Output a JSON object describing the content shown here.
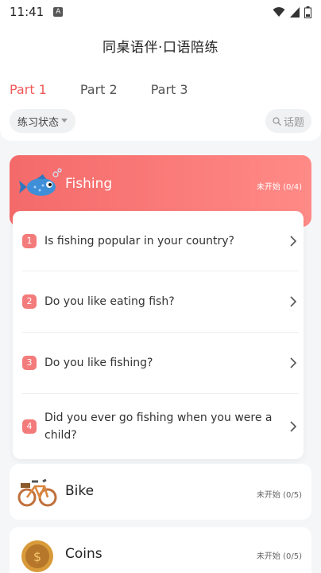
{
  "status_bar": {
    "time": "11:41",
    "notification_letter": "A"
  },
  "header": {
    "title": "同桌语伴·口语陪练"
  },
  "tabs": [
    {
      "label": "Part 1",
      "active": true
    },
    {
      "label": "Part 2",
      "active": false
    },
    {
      "label": "Part 3",
      "active": false
    }
  ],
  "filters": {
    "practice_status_label": "练习状态",
    "topic_search_label": "话题"
  },
  "topics": [
    {
      "title": "Fishing",
      "status": "未开始 (0/4)",
      "icon": "fish-icon",
      "expanded": true,
      "questions": [
        {
          "num": "1",
          "text": "Is fishing popular in your country?"
        },
        {
          "num": "2",
          "text": "Do you like eating fish?"
        },
        {
          "num": "3",
          "text": "Do you like fishing?"
        },
        {
          "num": "4",
          "text": "Did you ever go fishing when you were a child?"
        }
      ]
    },
    {
      "title": "Bike",
      "status": "未开始 (0/5)",
      "icon": "bike-icon"
    },
    {
      "title": "Coins",
      "status": "未开始 (0/5)",
      "icon": "coin-icon"
    }
  ],
  "colors": {
    "accent": "#ef5a5a",
    "card_gradient_start": "#f46a6a",
    "card_gradient_end": "#ff8a86"
  }
}
